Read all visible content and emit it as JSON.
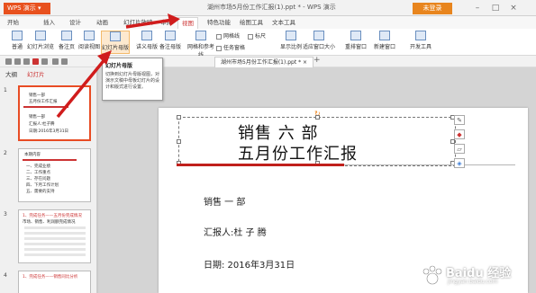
{
  "titlebar": {
    "app_name": "WPS 演示",
    "title": "湖州市场5月份工作汇报(1).ppt * - WPS 演示",
    "login_label": "未登录",
    "minimize": "–",
    "maximize": "□",
    "close": "×"
  },
  "tabs": [
    "开始",
    "插入",
    "设计",
    "动画",
    "幻灯片放映",
    "审阅",
    "视图",
    "特色功能",
    "绘图工具",
    "文本工具"
  ],
  "ribbon": {
    "normal": "普通",
    "slide_browse": "幻灯片浏览",
    "notes_page": "备注页",
    "reading_view": "阅读视图",
    "slide_master": "幻灯片母版",
    "handout_master": "讲义母版",
    "notes_master": "备注母版",
    "grid_guides": "网格和参考线",
    "gridlines": "网格线",
    "ruler": "标尺",
    "task_pane": "任务窗格",
    "fit": "显示比例",
    "fit_window": "适应窗口大小",
    "arrange_window": "重排窗口",
    "new_window": "新建窗口",
    "developer": "开发工具"
  },
  "doc_tab": "湖州市场5月份工作汇报(1).ppt *",
  "left_panel": {
    "outline_tab": "大纲",
    "slides_tab": "幻灯片",
    "thumbs": [
      {
        "num": "1",
        "lines": [
          "销售一部",
          "五月份工作汇报",
          "销售一部",
          "汇报人:杜子腾",
          "日期:2016年3月31日"
        ]
      },
      {
        "num": "2",
        "lines": [
          "本期内容",
          "一、完成业绩",
          "二、工作重点",
          "三、存在问题",
          "四、下月工作计划",
          "五、需要的支持"
        ]
      },
      {
        "num": "3",
        "lines": [
          "1、完成任务——五月份完成情况",
          "市场、销售、利润额完成情况"
        ]
      },
      {
        "num": "4",
        "lines": [
          "1、完成任务——销售同比分析"
        ]
      }
    ]
  },
  "tooltip": {
    "title": "幻灯片母版",
    "body": "切换到幻灯片母版视图，对演示文稿中母板幻灯片的设计和版式进行设置。"
  },
  "slide": {
    "title_line1": "销售 六 部",
    "title_line2": "五月份工作汇报",
    "dept": "销售 一 部",
    "reporter": "汇报人:杜 子 腾",
    "date": "日期: 2016年3月31日"
  },
  "watermark": {
    "text": "Baidu 经验",
    "sub": "jingyan.baidu.com"
  },
  "colors": {
    "accent": "#e8511e",
    "title_red": "#c0201c",
    "arrow_red": "#d01c1c"
  }
}
